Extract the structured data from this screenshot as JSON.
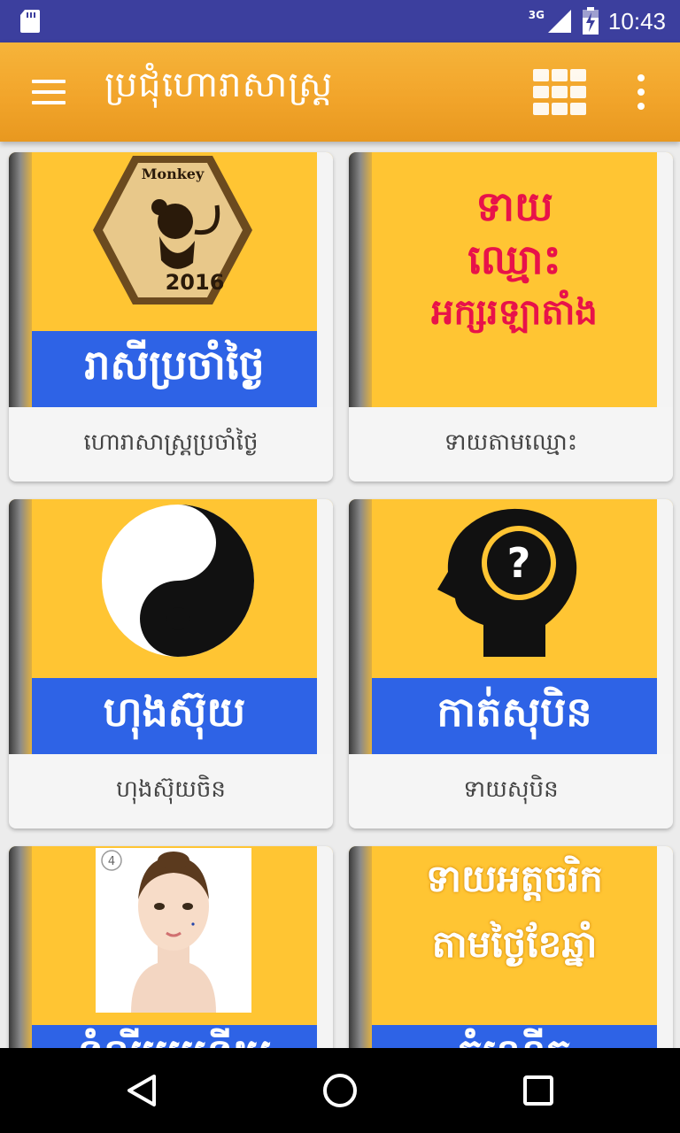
{
  "status": {
    "network": "3G",
    "time": "10:43"
  },
  "toolbar": {
    "title": "ប្រជុំហោរាសាស្រ្ត"
  },
  "cards": [
    {
      "caption": "ហោរាសាស្រ្តប្រចាំថ្ងៃ",
      "banner": "រាសីប្រចាំថ្ងៃ",
      "image": "monkey-zodiac-2016",
      "badge_top": "Monkey",
      "badge_year": "2016"
    },
    {
      "caption": "ទាយតាមឈ្មោះ",
      "lines": [
        "ទាយ",
        "ឈ្មោះ",
        "អក្សរឡាតាំង"
      ],
      "image": "name-text"
    },
    {
      "caption": "ហុងស៊ុយចិន",
      "banner": "ហុងស៊ុយ",
      "image": "yin-yang"
    },
    {
      "caption": "ទាយសុបិន",
      "banner": "កាត់សុបិន",
      "image": "head-question",
      "symbol": "?"
    },
    {
      "caption": "",
      "banner": "ទំលីរររររទីយ",
      "image": "face-moles",
      "badge": "4"
    },
    {
      "caption": "",
      "lines": [
        "ទាយអត្តចរិក",
        "តាមថ្ងៃខែឆ្នាំ"
      ],
      "banner": "កំណើត",
      "image": "character-text"
    }
  ],
  "colors": {
    "statusbar": "#3c3f9e",
    "toolbar": "#f2a52b",
    "thumb_bg": "#ffc533",
    "banner": "#2e63e6",
    "red_text": "#e8124a"
  }
}
